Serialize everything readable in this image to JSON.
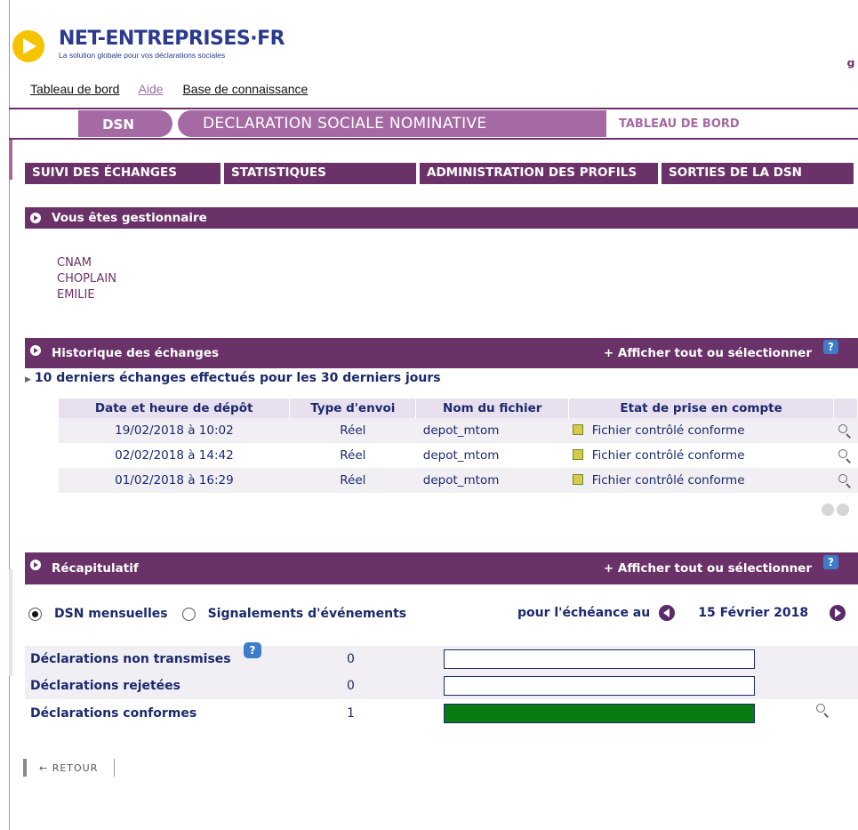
{
  "header": {
    "logo_title": "NET-ENTREPRISES·FR",
    "logo_subtitle": "La solution globale pour vos déclarations sociales",
    "links": [
      "Tableau de bord",
      "Aide",
      "Base de connaissance"
    ]
  },
  "banner": {
    "dsn": "DSN",
    "title": "DECLARATION SOCIALE NOMINATIVE",
    "tab": "TABLEAU DE BORD"
  },
  "nav": [
    "SUIVI DES ÉCHANGES",
    "STATISTIQUES",
    "ADMINISTRATION DES PROFILS",
    "SORTIES DE LA DSN"
  ],
  "gestionnaire": {
    "title": "Vous êtes gestionnaire",
    "lines": [
      "CNAM",
      "CHOPLAIN",
      "EMILIE"
    ]
  },
  "historique": {
    "title": "Historique des échanges",
    "show_all": "+ Afficher tout ou sélectionner",
    "help": "?",
    "subtitle": "10 derniers échanges effectués pour les 30 derniers jours",
    "columns": [
      "Date et heure de dépôt",
      "Type d'envoi",
      "Nom du fichier",
      "Etat de prise en compte"
    ],
    "rows": [
      {
        "date": "19/02/2018 à 10:02",
        "type": "Réel",
        "nom": "depot_mtom",
        "etat": "Fichier contrôlé conforme"
      },
      {
        "date": "02/02/2018 à 14:42",
        "type": "Réel",
        "nom": "depot_mtom",
        "etat": "Fichier contrôlé conforme"
      },
      {
        "date": "01/02/2018 à 16:29",
        "type": "Réel",
        "nom": "depot_mtom",
        "etat": "Fichier contrôlé conforme"
      }
    ]
  },
  "recap": {
    "title": "Récapitulatif",
    "show_all": "+ Afficher tout ou sélectionner",
    "help": "?",
    "radio1": "DSN mensuelles",
    "radio2": "Signalements d'événements",
    "echeance_label": "pour l'échéance au",
    "echeance_date": "15 Février 2018",
    "rows": [
      {
        "label": "Déclarations non transmises",
        "count": "0",
        "fill": 0
      },
      {
        "label": "Déclarations rejetées",
        "count": "0",
        "fill": 0
      },
      {
        "label": "Déclarations conformes",
        "count": "1",
        "fill": 1
      }
    ],
    "bar_fill_color": "#0a7a12"
  },
  "retour": "← RETOUR",
  "colors": {
    "brand": "#6a3268",
    "accent": "#a56aa3",
    "link_text": "#1a2a6c"
  }
}
